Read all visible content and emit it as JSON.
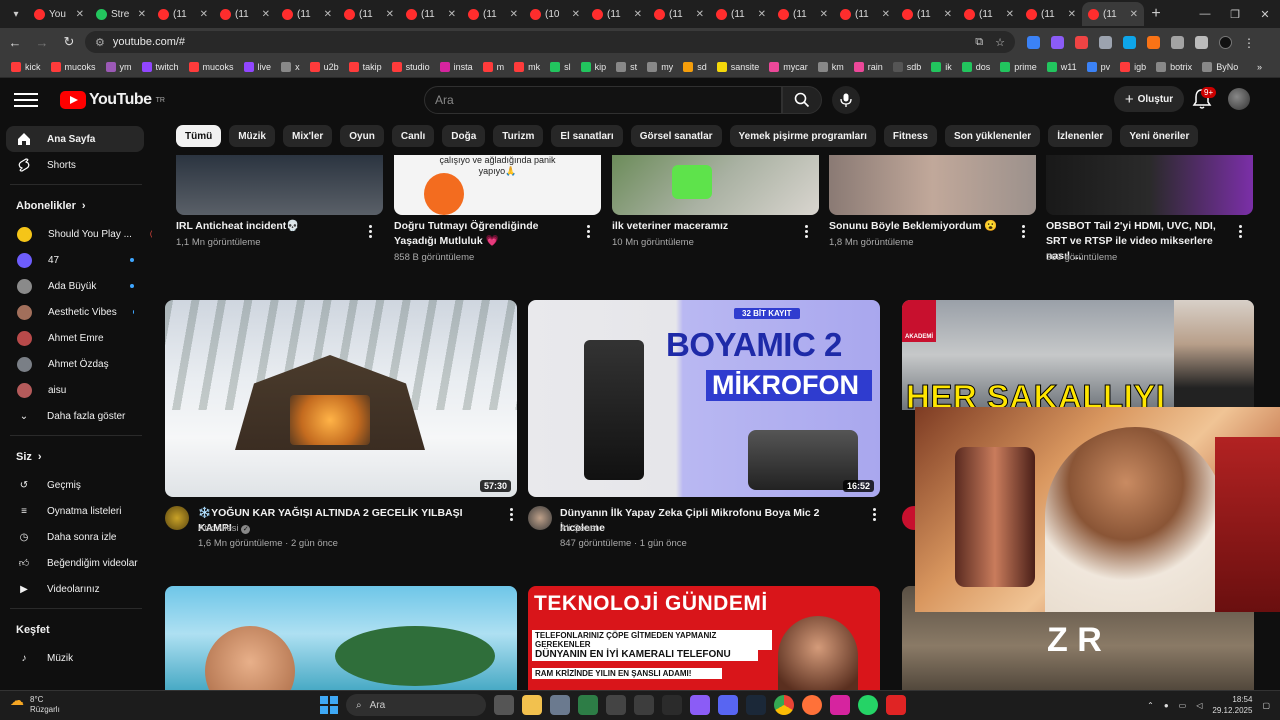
{
  "browser": {
    "tabs": [
      {
        "title": "You",
        "color": "#ff2d2d"
      },
      {
        "title": "Stre",
        "color": "#23c55e"
      },
      {
        "title": "(11",
        "color": "#ff2d2d"
      },
      {
        "title": "(11",
        "color": "#ff2d2d"
      },
      {
        "title": "(11",
        "color": "#ff2d2d"
      },
      {
        "title": "(11",
        "color": "#ff2d2d"
      },
      {
        "title": "(11",
        "color": "#ff2d2d"
      },
      {
        "title": "(11",
        "color": "#ff2d2d"
      },
      {
        "title": "(10",
        "color": "#ff2d2d"
      },
      {
        "title": "(11",
        "color": "#ff2d2d"
      },
      {
        "title": "(11",
        "color": "#ff2d2d"
      },
      {
        "title": "(11",
        "color": "#ff2d2d"
      },
      {
        "title": "(11",
        "color": "#ff2d2d"
      },
      {
        "title": "(11",
        "color": "#ff2d2d"
      },
      {
        "title": "(11",
        "color": "#ff2d2d"
      },
      {
        "title": "(11",
        "color": "#ff2d2d"
      },
      {
        "title": "(11",
        "color": "#ff2d2d"
      },
      {
        "title": "(11",
        "color": "#ff2d2d"
      }
    ],
    "url": "youtube.com/#",
    "bookmarks": [
      "kick",
      "mucoks",
      "ym",
      "twitch",
      "mucoks",
      "live",
      "x",
      "u2b",
      "takip",
      "studio",
      "insta",
      "m",
      "mk",
      "sl",
      "kip",
      "st",
      "my",
      "sd",
      "sansite",
      "mycar",
      "km",
      "rain",
      "sdb",
      "ik",
      "dos",
      "prime",
      "w11",
      "pv",
      "igb",
      "botrix",
      "ByNo"
    ]
  },
  "header": {
    "logo": "YouTube",
    "logo_sup": "TR",
    "search_placeholder": "Ara",
    "create_label": "Oluştur",
    "notif_badge": "9+"
  },
  "sidebar": {
    "home": "Ana Sayfa",
    "shorts": "Shorts",
    "subs_title": "Abonelikler",
    "subs": [
      {
        "name": "Should You Play ...",
        "live": true
      },
      {
        "name": "47",
        "dot": true
      },
      {
        "name": "Ada Büyük",
        "dot": true
      },
      {
        "name": "Aesthetic Vibes",
        "dot": true
      },
      {
        "name": "Ahmet Emre"
      },
      {
        "name": "Ahmet Özdaş"
      },
      {
        "name": "aisu"
      }
    ],
    "show_more": "Daha fazla göster",
    "you_title": "Siz",
    "you_items": [
      "Geçmiş",
      "Oynatma listeleri",
      "Daha sonra izle",
      "Beğendiğim videolar",
      "Videolarınız"
    ],
    "explore_title": "Keşfet",
    "explore_items": [
      "Müzik"
    ]
  },
  "chips": [
    "Tümü",
    "Müzik",
    "Mix'ler",
    "Oyun",
    "Canlı",
    "Doğa",
    "Turizm",
    "El sanatları",
    "Görsel sanatlar",
    "Yemek pişirme programları",
    "Fitness",
    "Son yüklenenler",
    "İzlenenler",
    "Yeni öneriler"
  ],
  "top_row": [
    {
      "title": "IRL Anticheat incident💀",
      "meta": "1,1 Mn görüntüleme"
    },
    {
      "title": "Doğru Tutmayı Öğrendiğinde Yaşadığı Mutluluk 💗",
      "meta": "858 B görüntüleme",
      "thumb_text": "çalışıyo ve ağladığında panik yapıyo🙏"
    },
    {
      "title": "ilk veteriner maceramız",
      "meta": "10 Mn görüntüleme"
    },
    {
      "title": "Sonunu Böyle Beklemiyordum 😮",
      "meta": "1,8 Mn görüntüleme"
    },
    {
      "title": "OBSBOT Tail 2'yi HDMI, UVC, NDI, SRT ve RTSP ile video mikserlere nasıl ...",
      "meta": "369 görüntüleme"
    }
  ],
  "videos": [
    {
      "title": "❄️YOĞUN KAR YAĞIŞI ALTINDA 2 GECELİK YILBAŞI KAMPI",
      "channel": "Atik Ailesi",
      "views": "1,6 Mn görüntüleme",
      "age": "2 gün önce",
      "duration": "57:30"
    },
    {
      "title": "Dünyanın İlk Yapay Zeka Çipli Mikrofonu Boya Mic 2 İnceleme",
      "channel": "Ali Şenel",
      "views": "847 görüntüleme",
      "age": "1 gün önce",
      "duration": "16:52",
      "thumb_top": "32 BİT KAYIT",
      "thumb_l1": "BOYAMIC 2",
      "thumb_l2": "MİKROFON"
    },
    {
      "title_partial": "HER SAKALLIYI",
      "badge": "AKADEMİ"
    }
  ],
  "bottom_row": [
    {
      "thumb_text": ""
    },
    {
      "thumb_title": "TEKNOLOJİ GÜNDEMİ",
      "thumb_l1": "TELEFONLARINIZ ÇÖPE GİTMEDEN YAPMANIZ GEREKENLER",
      "thumb_l2": "DÜNYANIN EN İYİ KAMERALI TELEFONU",
      "thumb_l3": "RAM KRİZİNDE YILIN EN ŞANSLI ADAMI!"
    },
    {
      "thumb_text": "Z R"
    }
  ],
  "taskbar": {
    "temp": "8°C",
    "weather": "Rüzgarlı",
    "search": "Ara",
    "time": "18:54",
    "date": "29.12.2025"
  }
}
